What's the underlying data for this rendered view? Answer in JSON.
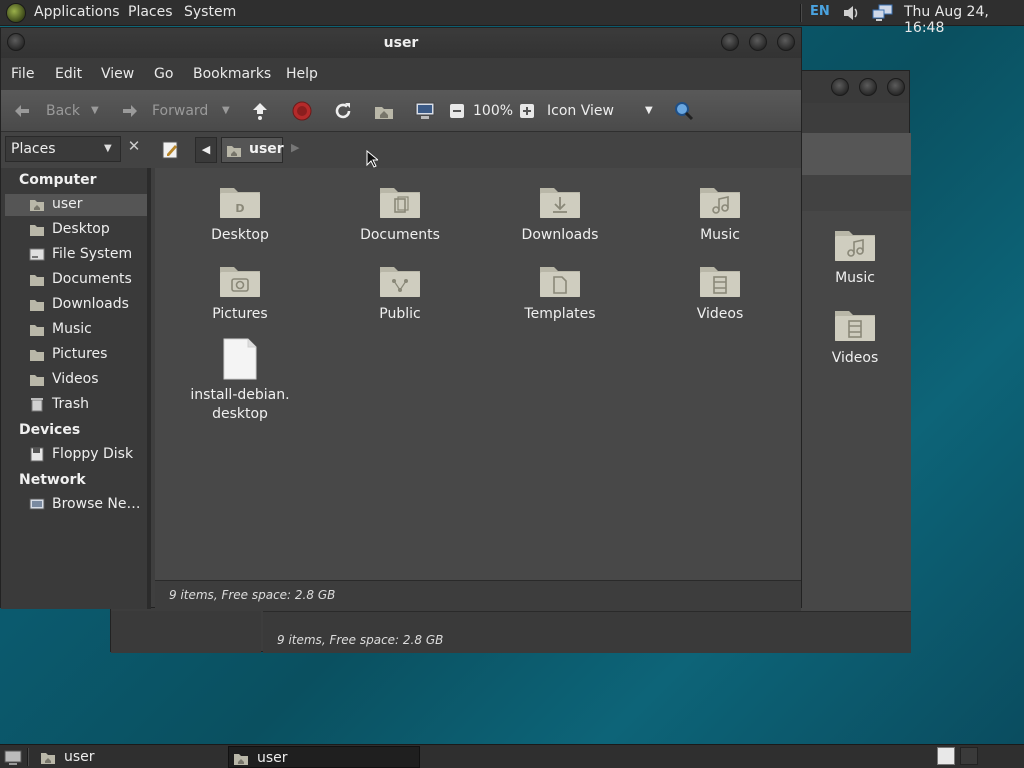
{
  "top_panel": {
    "menus": [
      "Applications",
      "Places",
      "System"
    ],
    "language": "EN",
    "clock": "Thu Aug 24, 16:48"
  },
  "window": {
    "title": "user",
    "menubar": [
      "File",
      "Edit",
      "View",
      "Go",
      "Bookmarks",
      "Help"
    ],
    "toolbar": {
      "back_label": "Back",
      "forward_label": "Forward",
      "zoom": "100%",
      "view_mode": "Icon View"
    },
    "places_combo": "Places",
    "path_segment": "user",
    "sidebar": {
      "sections": [
        {
          "heading": "Computer",
          "items": [
            {
              "label": "user",
              "icon": "home-folder-icon"
            },
            {
              "label": "Desktop",
              "icon": "folder-icon"
            },
            {
              "label": "File System",
              "icon": "drive-icon"
            },
            {
              "label": "Documents",
              "icon": "folder-icon"
            },
            {
              "label": "Downloads",
              "icon": "folder-icon"
            },
            {
              "label": "Music",
              "icon": "folder-icon"
            },
            {
              "label": "Pictures",
              "icon": "folder-icon"
            },
            {
              "label": "Videos",
              "icon": "folder-icon"
            },
            {
              "label": "Trash",
              "icon": "trash-icon"
            }
          ]
        },
        {
          "heading": "Devices",
          "items": [
            {
              "label": "Floppy Disk",
              "icon": "floppy-icon"
            }
          ]
        },
        {
          "heading": "Network",
          "items": [
            {
              "label": "Browse Ne…",
              "icon": "network-icon"
            }
          ]
        }
      ]
    },
    "files": [
      {
        "name": "Desktop",
        "glyph": "D"
      },
      {
        "name": "Documents",
        "glyph": "doc"
      },
      {
        "name": "Downloads",
        "glyph": "down"
      },
      {
        "name": "Music",
        "glyph": "music"
      },
      {
        "name": "Pictures",
        "glyph": "camera"
      },
      {
        "name": "Public",
        "glyph": "share"
      },
      {
        "name": "Templates",
        "glyph": "template"
      },
      {
        "name": "Videos",
        "glyph": "film"
      },
      {
        "name": "install-debian.\ndesktop",
        "glyph": "file"
      }
    ],
    "status": "9 items, Free space: 2.8 GB"
  },
  "background_window": {
    "visible_files": [
      "Music",
      "Videos"
    ],
    "status": "9 items, Free space: 2.8 GB"
  },
  "taskbar": {
    "items": [
      "user",
      "user"
    ]
  },
  "colors": {
    "accent_blue": "#4aa3e0",
    "stop_red": "#b42a2a",
    "folder": "#c9c7b8"
  }
}
